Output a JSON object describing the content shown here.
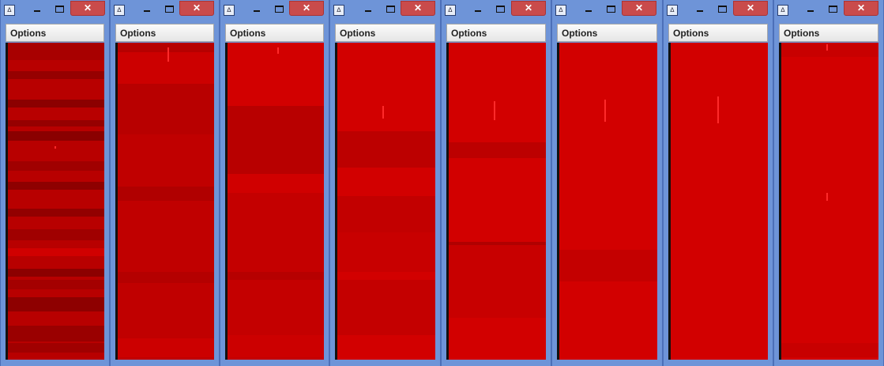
{
  "windows": [
    {
      "menu_label": "Options",
      "close_glyph": "✕",
      "icon_label": "∆"
    },
    {
      "menu_label": "Options",
      "close_glyph": "✕",
      "icon_label": "∆"
    },
    {
      "menu_label": "Options",
      "close_glyph": "✕",
      "icon_label": "∆"
    },
    {
      "menu_label": "Options",
      "close_glyph": "✕",
      "icon_label": "∆"
    },
    {
      "menu_label": "Options",
      "close_glyph": "✕",
      "icon_label": "∆"
    },
    {
      "menu_label": "Options",
      "close_glyph": "✕",
      "icon_label": "∆"
    },
    {
      "menu_label": "Options",
      "close_glyph": "✕",
      "icon_label": "∆"
    },
    {
      "menu_label": "Options",
      "close_glyph": "✕",
      "icon_label": "∆"
    }
  ],
  "colors": {
    "titlebar": "#6e94d8",
    "close_button": "#c94b4b",
    "canvas_red": "#d20000",
    "canvas_dark_red": "#b00000"
  },
  "icons": [
    "app-icon",
    "minimize-icon",
    "maximize-icon",
    "close-icon"
  ]
}
